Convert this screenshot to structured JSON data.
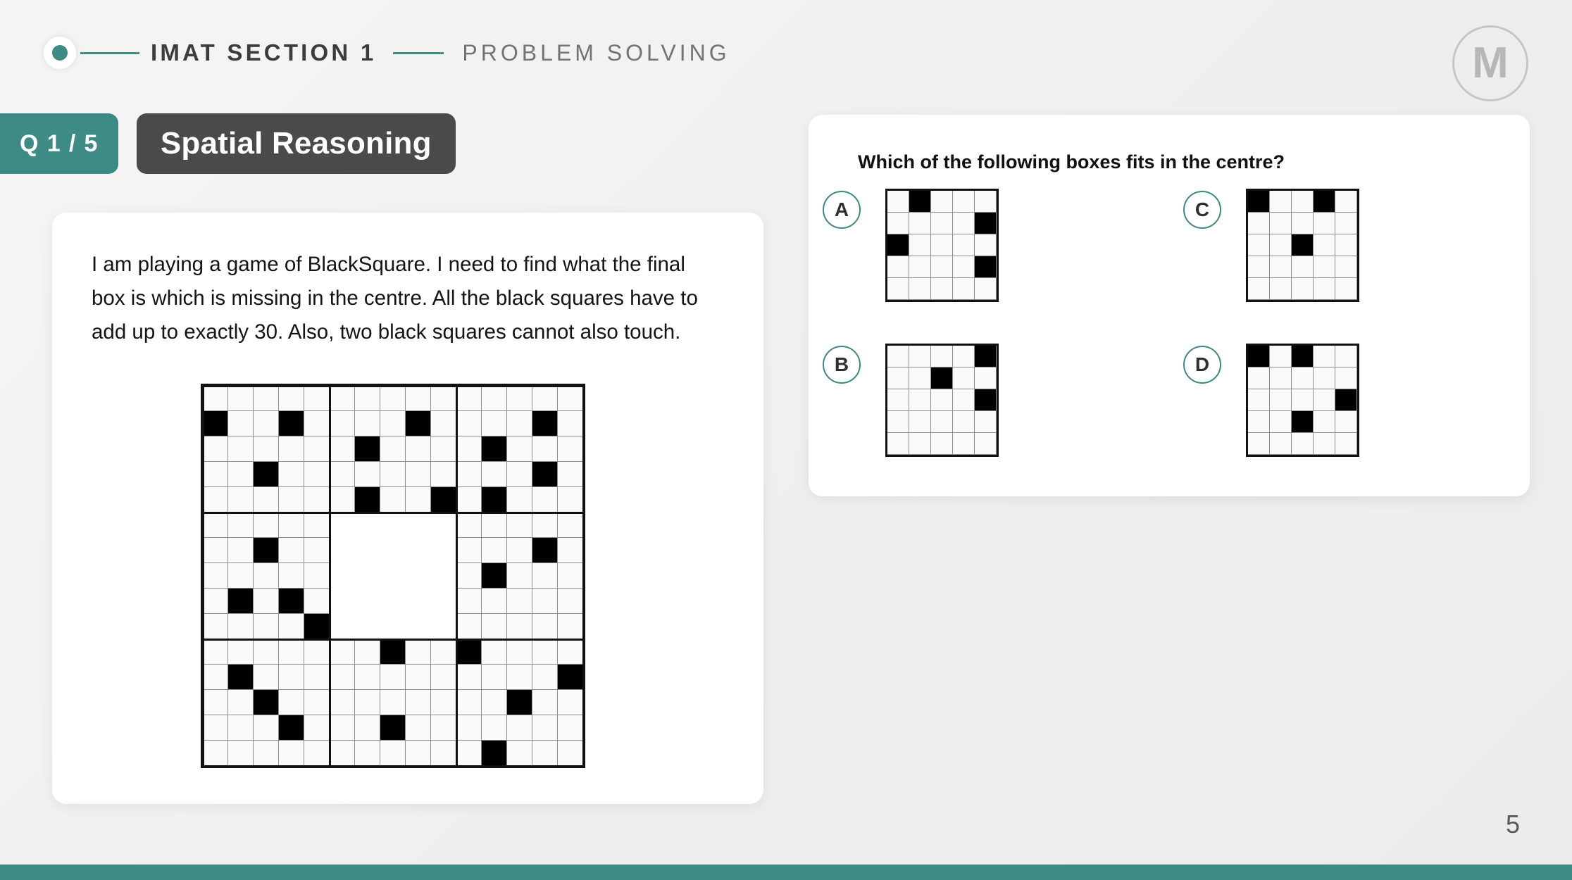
{
  "header": {
    "title": "IMAT SECTION 1",
    "subtitle": "PROBLEM SOLVING",
    "logo_letter": "M"
  },
  "badges": {
    "question_counter": "Q 1 / 5",
    "topic": "Spatial Reasoning"
  },
  "stem": {
    "text": "I am playing a game of BlackSquare. I need to find what the final box is which is missing in the centre. All the black squares have to add up to exactly 30. Also, two black squares cannot also touch."
  },
  "answers": {
    "question": "Which of the following boxes fits in the centre?",
    "options": [
      {
        "letter": "A",
        "black_cells": [
          [
            0,
            1
          ],
          [
            1,
            4
          ],
          [
            2,
            0
          ],
          [
            3,
            4
          ]
        ]
      },
      {
        "letter": "B",
        "black_cells": [
          [
            0,
            4
          ],
          [
            1,
            2
          ],
          [
            2,
            4
          ]
        ]
      },
      {
        "letter": "C",
        "black_cells": [
          [
            0,
            0
          ],
          [
            0,
            3
          ],
          [
            2,
            2
          ]
        ]
      },
      {
        "letter": "D",
        "black_cells": [
          [
            0,
            0
          ],
          [
            0,
            2
          ],
          [
            2,
            4
          ],
          [
            3,
            2
          ]
        ]
      }
    ],
    "option_grid_size": 5
  },
  "puzzle_grid": {
    "size": 15,
    "block_size": 5,
    "missing_block": {
      "row_start": 5,
      "col_start": 5,
      "rows": 5,
      "cols": 5
    },
    "black_cells": [
      [
        1,
        0
      ],
      [
        1,
        3
      ],
      [
        1,
        8
      ],
      [
        1,
        13
      ],
      [
        2,
        6
      ],
      [
        2,
        11
      ],
      [
        3,
        2
      ],
      [
        3,
        13
      ],
      [
        4,
        6
      ],
      [
        4,
        9
      ],
      [
        4,
        11
      ],
      [
        6,
        2
      ],
      [
        6,
        13
      ],
      [
        7,
        11
      ],
      [
        8,
        1
      ],
      [
        8,
        3
      ],
      [
        9,
        4
      ],
      [
        10,
        7
      ],
      [
        10,
        10
      ],
      [
        11,
        1
      ],
      [
        11,
        14
      ],
      [
        12,
        2
      ],
      [
        12,
        12
      ],
      [
        13,
        3
      ],
      [
        13,
        7
      ],
      [
        14,
        11
      ]
    ]
  },
  "footer": {
    "page_number": "5"
  },
  "colors": {
    "accent_teal": "#3d8b84",
    "topic_dark": "#4a4a48",
    "black": "#000000"
  }
}
